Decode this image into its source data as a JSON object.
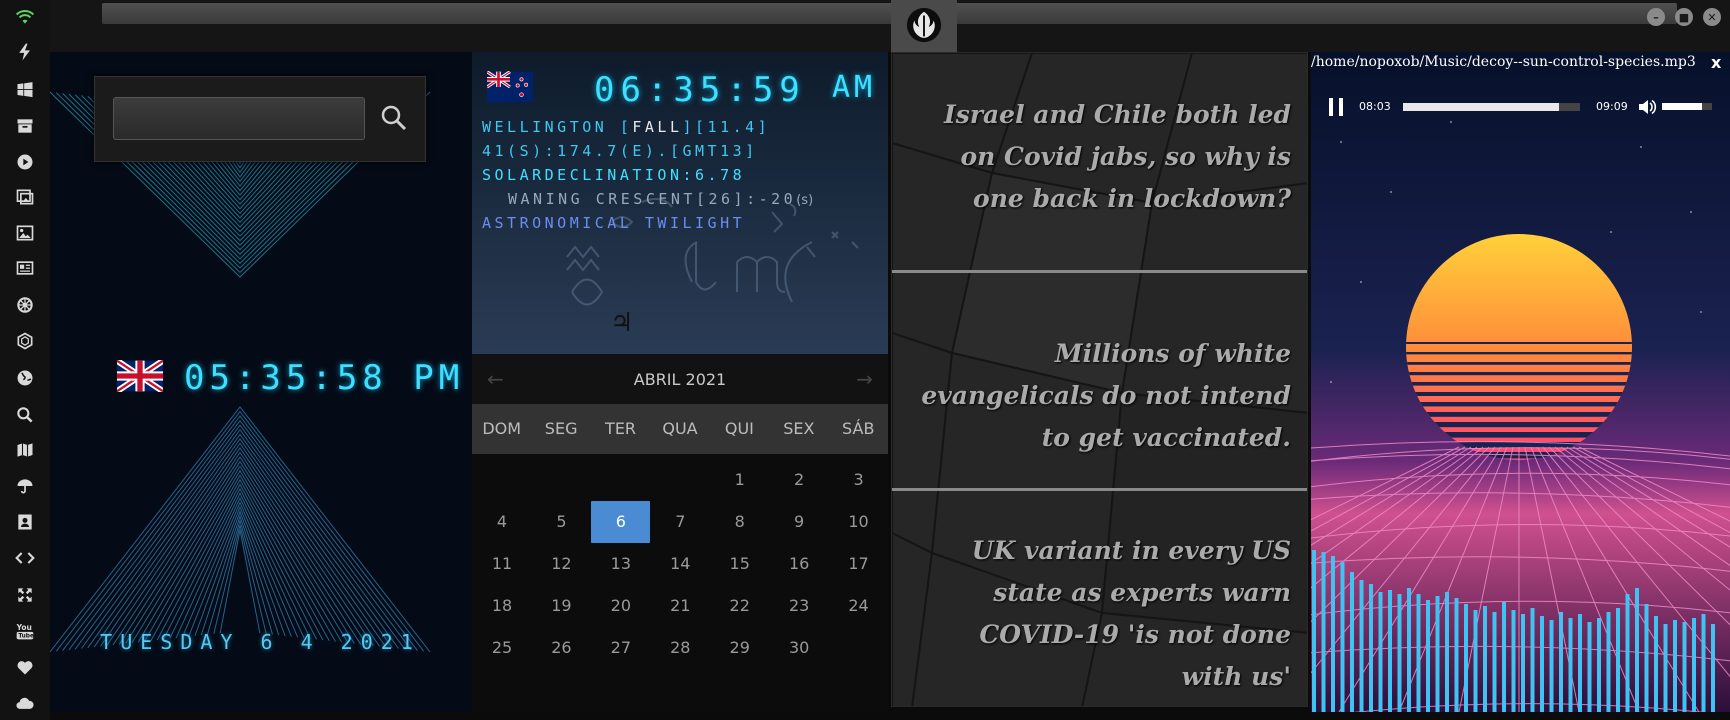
{
  "sidebar": {
    "icons": [
      "wifi-icon",
      "bolt-icon",
      "windows-icon",
      "archive-icon",
      "play-icon",
      "photos-icon",
      "image-icon",
      "news-icon",
      "dharma-wheel-icon",
      "hexagon-icon",
      "globe-icon",
      "search-icon",
      "map-icon",
      "umbrella-icon",
      "contacts-icon",
      "code-icon",
      "expand-icon",
      "youtube-icon",
      "heart-icon",
      "cloud-icon"
    ],
    "accent": "#5fd35f"
  },
  "window": {
    "emblem": "rebel-alliance-icon",
    "minimize_label": "–",
    "maximize_label": "■",
    "close_label": "✕"
  },
  "clock_uk": {
    "time": "05:35:58 PM",
    "date": "TUESDAY 6 4 2021",
    "flag": "uk-flag"
  },
  "search": {
    "value": "",
    "placeholder": ""
  },
  "clock_nz": {
    "flag": "nz-flag",
    "time": "06:35:59",
    "ampm": "AM",
    "line1_prefix": "WELLINGTON [",
    "line1_season": "FALL",
    "line1_suffix": "][11.4]",
    "line2": "41(S):174.7(E).[GMT13]",
    "line3": "SOLARDECLINATION:6.78",
    "line4": "WANING CRESCENT[26]:-20",
    "line4_unit": "(s)",
    "line5": "ASTRONOMICAL TWILIGHT",
    "zodiac_glyph": "♃"
  },
  "calendar": {
    "month_label": "ABRIL 2021",
    "prev": "←",
    "next": "→",
    "weekdays": [
      "DOM",
      "SEG",
      "TER",
      "QUA",
      "QUI",
      "SEX",
      "SÁB"
    ],
    "first_weekday": 4,
    "days_in_month": 30,
    "today": 6,
    "today_color": "#4a8bd4"
  },
  "news": {
    "items": [
      "Israel and Chile both led on Covid jabs, so why is one back in lockdown?",
      "Millions of white evangelicals do not intend to get vaccinated.",
      "UK variant in every US state as experts warn COVID-19 'is not done with us'"
    ]
  },
  "player": {
    "path": "/home/nopoxob/Music/decoy--sun-control-species.mp3",
    "close": "x",
    "current_time": "08:03",
    "duration": "09:09",
    "progress": 0.88,
    "volume": 0.8,
    "state": "playing"
  }
}
